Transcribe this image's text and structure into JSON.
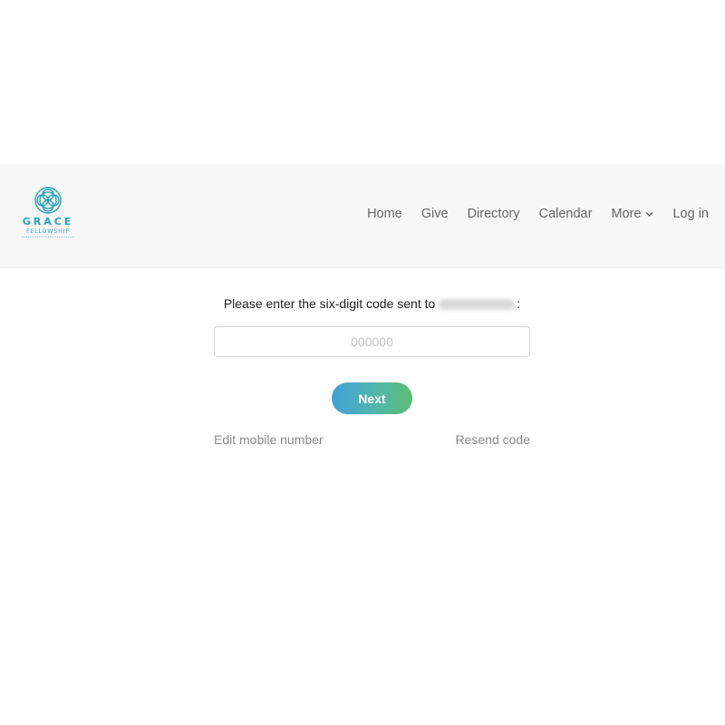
{
  "header": {
    "logo": {
      "name": "GRACE",
      "sub": "FELLOWSHIP",
      "icon": "grace-fellowship-emblem-icon",
      "color": "#26a4c0"
    },
    "nav": {
      "items": [
        {
          "label": "Home"
        },
        {
          "label": "Give"
        },
        {
          "label": "Directory"
        },
        {
          "label": "Calendar"
        }
      ],
      "more_label": "More",
      "more_icon": "chevron-down-icon",
      "login_label": "Log in"
    }
  },
  "verify": {
    "prompt_text": "Please enter the six-digit code sent to",
    "prompt_suffix": ":",
    "code_placeholder": "000000",
    "code_value": "",
    "next_label": "Next",
    "edit_label": "Edit mobile number",
    "resend_label": "Resend code"
  },
  "colors": {
    "accent": "#26a4c0",
    "button_gradient_start": "#3fa3d8",
    "button_gradient_end": "#5cbd73",
    "header_bg": "#f7f7f7"
  }
}
